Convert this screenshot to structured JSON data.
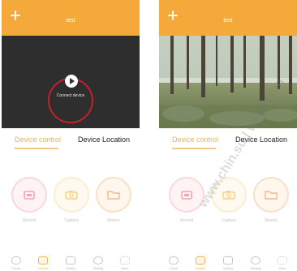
{
  "colors": {
    "accent": "#f4a93a",
    "active_tab": "#f0b35a",
    "ring": "#c8202a"
  },
  "left_phone": {
    "plus_icon": "plus-icon",
    "title": "test",
    "connect_label": "Connect device",
    "tab_device_control": "Device control",
    "tab_device_location": "Device Location",
    "controls": [
      {
        "label": "Record",
        "icon": "record-icon"
      },
      {
        "label": "Capture",
        "icon": "camera-icon"
      },
      {
        "label": "Device",
        "icon": "folder-icon"
      }
    ],
    "nav": [
      {
        "label": "Cloud",
        "icon": "cloud-icon"
      },
      {
        "label": "Device",
        "icon": "device-icon"
      },
      {
        "label": "Gallery",
        "icon": "gallery-icon"
      },
      {
        "label": "Setting",
        "icon": "settings-icon"
      },
      {
        "label": "More",
        "icon": "more-icon"
      }
    ]
  },
  "right_phone": {
    "title": "test",
    "tab_device_control": "Device control",
    "tab_device_location": "Device Location",
    "controls": [
      {
        "label": "Record",
        "icon": "record-icon"
      },
      {
        "label": "Capture",
        "icon": "camera-icon"
      },
      {
        "label": "Device",
        "icon": "folder-icon"
      }
    ],
    "nav": [
      {
        "label": "Cloud",
        "icon": "cloud-icon"
      },
      {
        "label": "Device",
        "icon": "device-icon"
      },
      {
        "label": "Gallery",
        "icon": "gallery-icon"
      },
      {
        "label": "Setting",
        "icon": "settings-icon"
      },
      {
        "label": "More",
        "icon": "more-icon"
      }
    ]
  },
  "watermark": "www.chin.su | www.chin"
}
